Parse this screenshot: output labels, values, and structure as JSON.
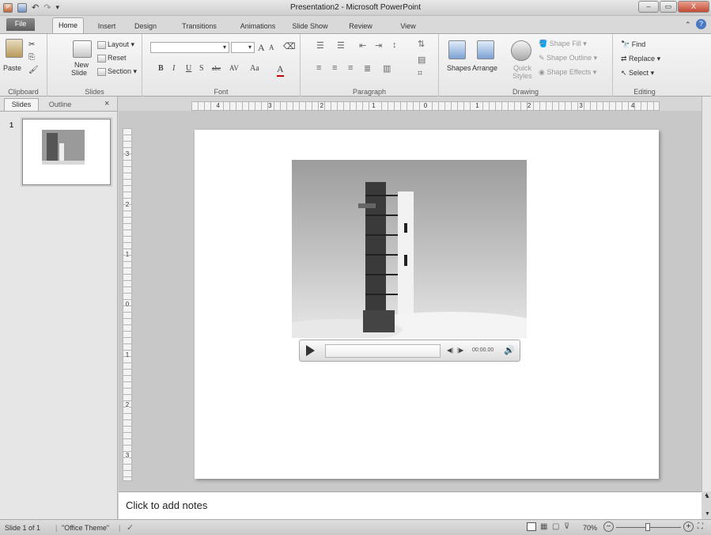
{
  "window": {
    "title": "Presentation2 - Microsoft PowerPoint",
    "minimize": "–",
    "restore": "▭",
    "close": "X"
  },
  "qat": {
    "app_icon": "P",
    "save": "💾",
    "undo": "↶",
    "redo": "↷",
    "customize": "▾"
  },
  "tabs": {
    "file": "File",
    "home": "Home",
    "insert": "Insert",
    "design": "Design",
    "transitions": "Transitions",
    "animations": "Animations",
    "slideshow": "Slide Show",
    "review": "Review",
    "view": "View"
  },
  "ribbon": {
    "clipboard": {
      "paste": "Paste",
      "label": "Clipboard"
    },
    "slides": {
      "new_slide_1": "New",
      "new_slide_2": "Slide",
      "layout": "Layout",
      "reset": "Reset",
      "section": "Section",
      "label": "Slides"
    },
    "font": {
      "bold": "B",
      "italic": "I",
      "underline": "U",
      "shadow": "S",
      "strike": "abc",
      "spacing": "AV",
      "case": "Aa",
      "grow": "A",
      "shrink": "A",
      "color": "A",
      "label": "Font"
    },
    "paragraph": {
      "label": "Paragraph"
    },
    "drawing": {
      "shapes": "Shapes",
      "arrange": "Arrange",
      "quick_styles_1": "Quick",
      "quick_styles_2": "Styles",
      "fill": "Shape Fill",
      "outline": "Shape Outline",
      "effects": "Shape Effects",
      "label": "Drawing"
    },
    "editing": {
      "find": "Find",
      "replace": "Replace",
      "select": "Select",
      "label": "Editing"
    }
  },
  "panel": {
    "slides_tab": "Slides",
    "outline_tab": "Outline",
    "close": "×",
    "slide_number": "1"
  },
  "ruler": {
    "h_numbers": [
      "4",
      "3",
      "2",
      "1",
      "0",
      "1",
      "2",
      "3",
      "4"
    ],
    "v_numbers": [
      "3",
      "2",
      "1",
      "0",
      "1",
      "2",
      "3"
    ]
  },
  "media": {
    "time": "00:00.00"
  },
  "notes": {
    "placeholder": "Click to add notes"
  },
  "status": {
    "slide_info": "Slide 1 of 1",
    "theme": "\"Office Theme\"",
    "zoom": "70%",
    "minus": "−",
    "plus": "+"
  }
}
